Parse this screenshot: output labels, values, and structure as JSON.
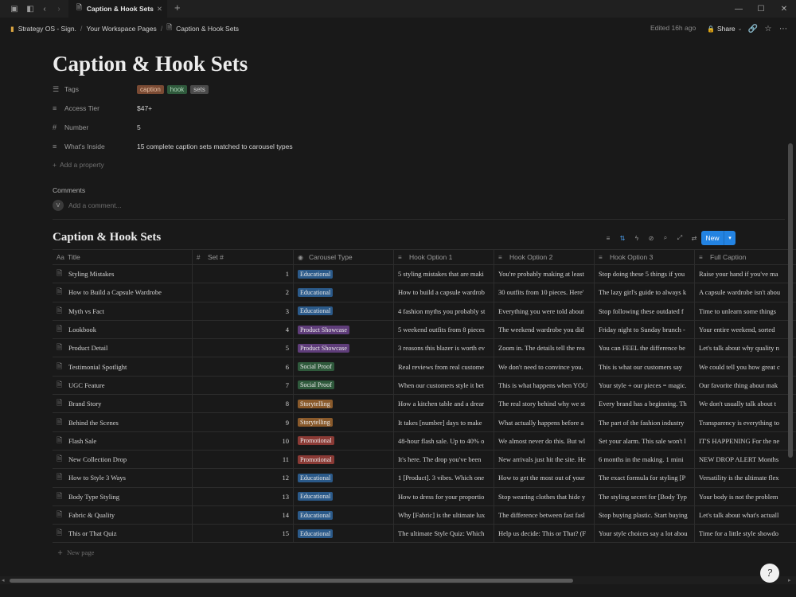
{
  "tab": {
    "title": "Caption & Hook Sets"
  },
  "breadcrumb": [
    "Strategy OS - Sign.",
    "Your Workspace Pages",
    "Caption & Hook Sets"
  ],
  "topbar": {
    "edited": "Edited 16h ago",
    "share": "Share"
  },
  "page": {
    "title": "Caption & Hook Sets",
    "properties": {
      "tags": {
        "label": "Tags",
        "values": [
          {
            "text": "caption",
            "color": "#7a4a33",
            "fg": "#e8c3a8"
          },
          {
            "text": "hook",
            "color": "#2f5a3c",
            "fg": "#b6dcc0"
          },
          {
            "text": "sets",
            "color": "#4a4a4a",
            "fg": "#d0d0d0"
          }
        ]
      },
      "access_tier": {
        "label": "Access Tier",
        "value": "$47+"
      },
      "number": {
        "label": "Number",
        "value": "5"
      },
      "whats_inside": {
        "label": "What's Inside",
        "value": "15 complete caption sets matched to carousel types"
      }
    },
    "add_property": "Add a property",
    "comments_label": "Comments",
    "comment_placeholder": "Add a comment...",
    "avatar_initial": "V"
  },
  "database": {
    "title": "Caption & Hook Sets",
    "new_button": "New",
    "new_page": "New page",
    "columns": [
      "Title",
      "Set #",
      "Carousel Type",
      "Hook Option 1",
      "Hook Option 2",
      "Hook Option 3",
      "Full Caption"
    ],
    "type_colors": {
      "Educational": "#2b5a8a",
      "Product Showcase": "#5f3d7a",
      "Social Proof": "#2f5a3c",
      "Storytelling": "#8a5a2b",
      "Promotional": "#8a3a35"
    },
    "rows": [
      {
        "title": "Styling Mistakes",
        "set": "1",
        "type": "Educational",
        "h1": "5 styling mistakes that are maki",
        "h2": "You're probably making at least",
        "h3": "Stop doing these 5 things if you",
        "fc": "Raise your hand if you've ma"
      },
      {
        "title": "How to Build a Capsule Wardrobe",
        "set": "2",
        "type": "Educational",
        "h1": "How to build a capsule wardrob",
        "h2": "30 outfits from 10 pieces. Here'",
        "h3": "The lazy girl's guide to always k",
        "fc": "A capsule wardrobe isn't abou"
      },
      {
        "title": "Myth vs Fact",
        "set": "3",
        "type": "Educational",
        "h1": "4 fashion myths you probably st",
        "h2": "Everything you were told about",
        "h3": "Stop following these outdated f",
        "fc": "Time to unlearn some things"
      },
      {
        "title": "Lookbook",
        "set": "4",
        "type": "Product Showcase",
        "h1": "5 weekend outfits from 8 pieces",
        "h2": "The weekend wardrobe you did",
        "h3": "Friday night to Sunday brunch -",
        "fc": "Your entire weekend, sorted"
      },
      {
        "title": "Product Detail",
        "set": "5",
        "type": "Product Showcase",
        "h1": "3 reasons this blazer is worth ev",
        "h2": "Zoom in. The details tell the rea",
        "h3": "You can FEEL the difference be",
        "fc": "Let's talk about why quality n"
      },
      {
        "title": "Testimonial Spotlight",
        "set": "6",
        "type": "Social Proof",
        "h1": "Real reviews from real custome",
        "h2": "We don't need to convince you.",
        "h3": "This is what our customers say",
        "fc": "We could tell you how great c"
      },
      {
        "title": "UGC Feature",
        "set": "7",
        "type": "Social Proof",
        "h1": "When our customers style it bet",
        "h2": "This is what happens when YOU",
        "h3": "Your style + our pieces = magic.",
        "fc": "Our favorite thing about mak"
      },
      {
        "title": "Brand Story",
        "set": "8",
        "type": "Storytelling",
        "h1": "How a kitchen table and a drear",
        "h2": "The real story behind why we st",
        "h3": "Every brand has a beginning. Th",
        "fc": "We don't usually talk about t"
      },
      {
        "title": "Behind the Scenes",
        "set": "9",
        "type": "Storytelling",
        "h1": "It takes [number] days to make",
        "h2": "What actually happens before a",
        "h3": "The part of the fashion industry",
        "fc": "Transparency is everything to"
      },
      {
        "title": "Flash Sale",
        "set": "10",
        "type": "Promotional",
        "h1": "48-hour flash sale. Up to 40% o",
        "h2": "We almost never do this. But wl",
        "h3": "Set your alarm. This sale won't l",
        "fc": "IT'S HAPPENING For the ne"
      },
      {
        "title": "New Collection Drop",
        "set": "11",
        "type": "Promotional",
        "h1": "It's here. The drop you've been",
        "h2": "New arrivals just hit the site. He",
        "h3": "6 months in the making. 1 mini",
        "fc": "NEW DROP ALERT Months"
      },
      {
        "title": "How to Style 3 Ways",
        "set": "12",
        "type": "Educational",
        "h1": "1 [Product]. 3 vibes. Which one",
        "h2": "How to get the most out of your",
        "h3": "The exact formula for styling [P",
        "fc": "Versatility is the ultimate flex"
      },
      {
        "title": "Body Type Styling",
        "set": "13",
        "type": "Educational",
        "h1": "How to dress for your proportio",
        "h2": "Stop wearing clothes that hide y",
        "h3": "The styling secret for [Body Typ",
        "fc": "Your body is not the problem"
      },
      {
        "title": "Fabric & Quality",
        "set": "14",
        "type": "Educational",
        "h1": "Why [Fabric] is the ultimate lux",
        "h2": "The difference between fast fasl",
        "h3": "Stop buying plastic. Start buying",
        "fc": "Let's talk about what's actuall"
      },
      {
        "title": "This or That Quiz",
        "set": "15",
        "type": "Educational",
        "h1": "The ultimate Style Quiz: Which",
        "h2": "Help us decide: This or That? (F",
        "h3": "Your style choices say a lot abou",
        "fc": "Time for a little style showdo"
      }
    ]
  }
}
